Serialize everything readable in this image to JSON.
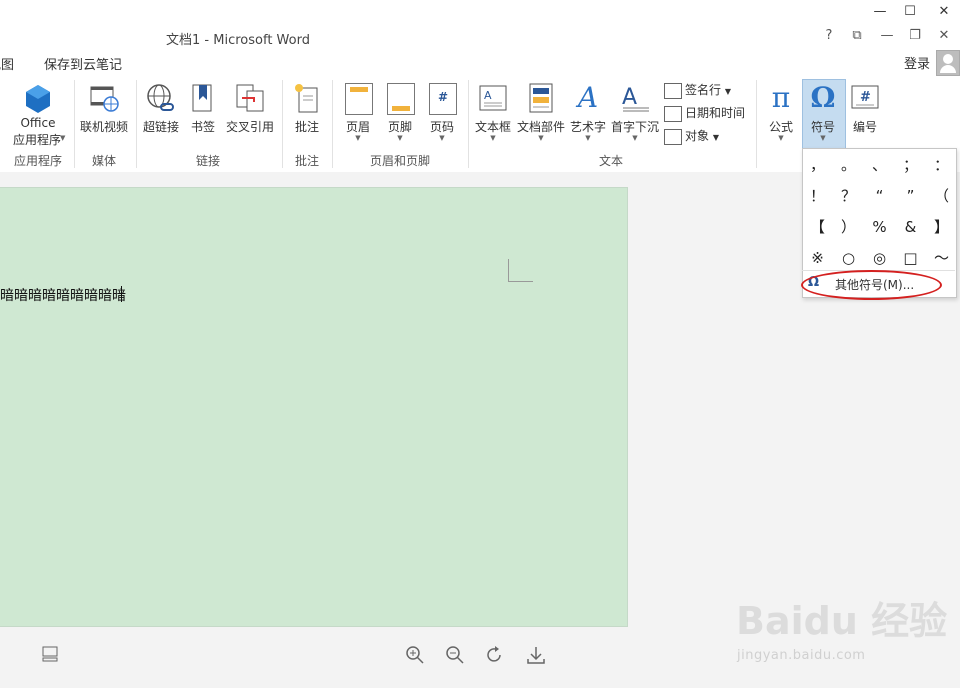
{
  "window": {
    "title": "文档1 - Microsoft Word",
    "controls": {
      "minimize": "—",
      "maximize": "☐",
      "close": "✕"
    },
    "quick": {
      "help": "?",
      "ribbon_toggle": "⧉",
      "min": "—",
      "restore": "❐",
      "close": "✕"
    }
  },
  "menu": {
    "items": [
      "视图",
      "保存到云笔记"
    ],
    "login": "登录"
  },
  "ribbon": {
    "buttons": {
      "office_apps": {
        "line1": "Office",
        "line2": "应用程序"
      },
      "online_video": "联机视频",
      "hyperlink": "超链接",
      "bookmark": "书签",
      "cross_ref": "交叉引用",
      "comment": "批注",
      "header": "页眉",
      "footer": "页脚",
      "page_number": "页码",
      "textbox": "文本框",
      "doc_parts": "文档部件",
      "wordart": "艺术字",
      "dropcap": "首字下沉",
      "signature": "签名行",
      "datetime": "日期和时间",
      "object": "对象",
      "equation": "公式",
      "symbol": "符号",
      "number": "编号"
    },
    "groups": {
      "apps": "应用程序",
      "media": "媒体",
      "links": "链接",
      "comments": "批注",
      "header_footer": "页眉和页脚",
      "text": "文本"
    }
  },
  "document": {
    "text": "暗暗暗暗暗暗暗暗暗"
  },
  "symbols": {
    "cells": [
      "，",
      "。",
      "、",
      "；",
      "：",
      "！",
      "？",
      "“",
      "”",
      "（",
      "【",
      "）",
      "%",
      "&",
      "】",
      "※",
      "○",
      "◎",
      "□",
      "～"
    ],
    "more_icon": "Ω",
    "more_label": "其他符号(M)..."
  },
  "watermark": {
    "main": "Baidu 经验",
    "sub": "jingyan.baidu.com"
  },
  "colors": {
    "accent": "#2b5797",
    "page": "#cfe8d2",
    "highlight": "#d4201f",
    "active": "#c5dcf0"
  }
}
